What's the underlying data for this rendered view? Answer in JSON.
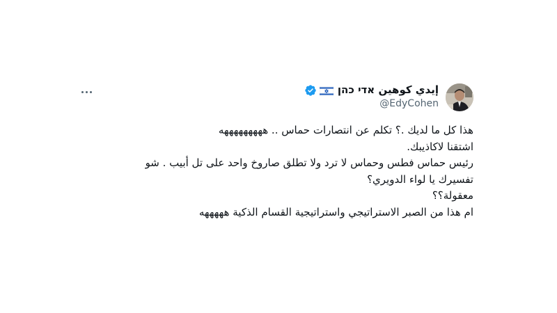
{
  "tweet": {
    "author": {
      "display_name": "إيدي كوهين אדי כהן",
      "handle": "@EdyCohen",
      "flag_icon": "israel-flag-icon",
      "verified_icon": "verified-badge-icon",
      "verified_color": "#1d9bf0"
    },
    "more_icon": "more-options-icon",
    "lines": [
      "هذا كل ما لديك .؟ تكلم عن انتصارات حماس .. هههههههههه",
      "اشتقنا لاكاذيبك.",
      "رئيس حماس فطس وحماس لا ترد ولا تطلق صاروخ واحد على تل أبيب . شو",
      "تفسيرك يا لواء الدويري؟",
      "معقولة؟؟",
      "ام هذا من الصبر الاستراتيجي واستراتيجية القسام الذكية هههههه"
    ]
  },
  "colors": {
    "text": "#0f1419",
    "secondary": "#536471",
    "accent": "#1d9bf0",
    "background": "#ffffff"
  }
}
